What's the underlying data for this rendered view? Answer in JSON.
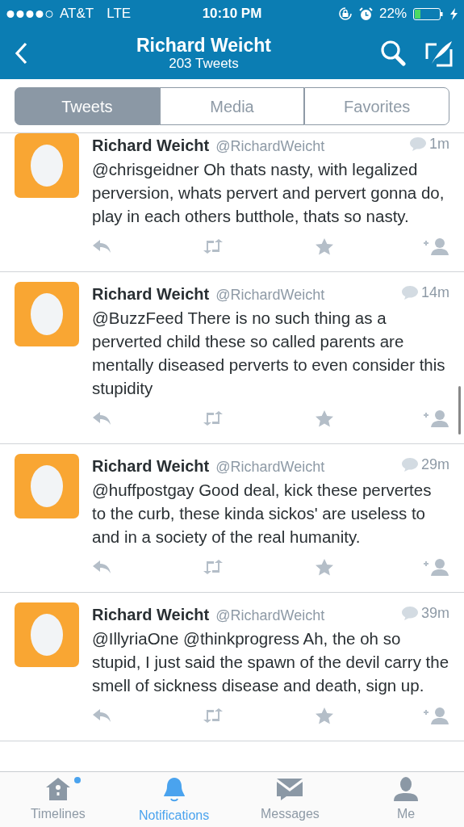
{
  "status_bar": {
    "carrier": "AT&T",
    "network": "LTE",
    "time": "10:10 PM",
    "battery": "22%"
  },
  "header": {
    "title": "Richard Weicht",
    "subtitle": "203 Tweets"
  },
  "tabs": [
    {
      "label": "Tweets",
      "selected": true
    },
    {
      "label": "Media",
      "selected": false
    },
    {
      "label": "Favorites",
      "selected": false
    }
  ],
  "tweets": [
    {
      "name": "Richard Weicht",
      "handle": "@RichardWeicht",
      "time": "1m",
      "text": "@chrisgeidner Oh thats nasty, with legalized perversion, whats pervert and pervert gonna do, play in each others butthole, thats so nasty."
    },
    {
      "name": "Richard Weicht",
      "handle": "@RichardWeicht",
      "time": "14m",
      "text": "@BuzzFeed There is no such thing as a perverted child these so called parents are mentally diseased perverts to even consider this stupidity"
    },
    {
      "name": "Richard Weicht",
      "handle": "@RichardWeicht",
      "time": "29m",
      "text": "@huffpostgay Good deal, kick these pervertes to the curb, these kinda sickos' are useless to and in a society of the real humanity."
    },
    {
      "name": "Richard Weicht",
      "handle": "@RichardWeicht",
      "time": "39m",
      "text": "@IllyriaOne @thinkprogress Ah, the oh so stupid, I just said the spawn of the devil carry the smell of sickness disease and death, sign up."
    }
  ],
  "tab_bar": [
    {
      "kind": "home",
      "label": "Timelines",
      "selected": false,
      "unread": true
    },
    {
      "kind": "bell",
      "label": "Notifications",
      "selected": true,
      "unread": false
    },
    {
      "kind": "mail",
      "label": "Messages",
      "selected": false,
      "unread": false
    },
    {
      "kind": "person",
      "label": "Me",
      "selected": false,
      "unread": false
    }
  ]
}
